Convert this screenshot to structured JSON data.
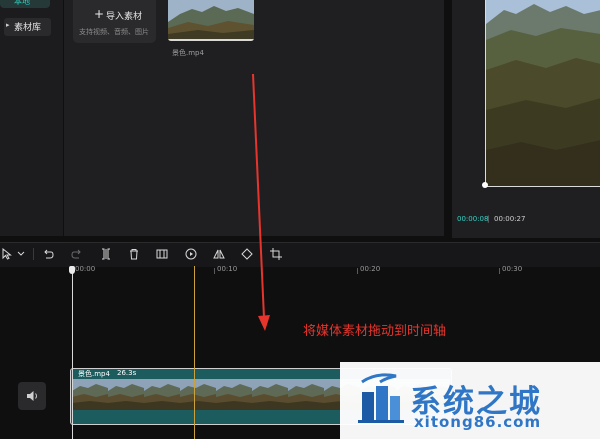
{
  "left_nav": {
    "top_item_label": "本地",
    "library_label": "素材库",
    "library_arrow": "▸"
  },
  "media": {
    "import_label": "导入素材",
    "import_hint": "支持视频、音频、图片",
    "clip_filename": "景色.mp4"
  },
  "preview": {
    "current_time": "00:00:08",
    "separator": "|",
    "total_time": "00:00:27"
  },
  "toolbar": {
    "icons": [
      "pointer-icon",
      "chevron-down-icon",
      "undo-icon",
      "redo-icon",
      "split-icon",
      "delete-icon",
      "freeze-icon",
      "play-circle-icon",
      "mirror-icon",
      "rotate-icon",
      "crop-icon"
    ]
  },
  "ruler": {
    "labels": [
      "00:00",
      "00:10",
      "00:20",
      "00:30"
    ]
  },
  "timeline": {
    "clip_title": "景色.mp4",
    "clip_duration": "26.3s"
  },
  "annotation": {
    "text": "将媒体素材拖动到时间轴"
  },
  "watermark": {
    "title": "系统之城",
    "url": "xitong86.com"
  },
  "colors": {
    "accent": "#33d3c5",
    "clip": "#1c5c5e",
    "annotation": "#e5352c",
    "watermark": "#2f76c6",
    "playhead_marker": "#c9a23f"
  }
}
